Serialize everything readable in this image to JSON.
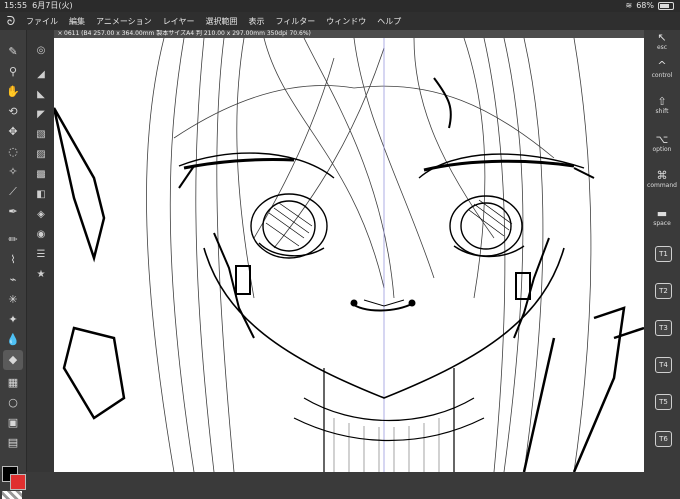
{
  "status_bar": {
    "time": "15:55",
    "date": "6月7日(火)",
    "battery": "68%"
  },
  "menu": {
    "items": [
      "ファイル",
      "編集",
      "アニメーション",
      "レイヤー",
      "選択範囲",
      "表示",
      "フィルター",
      "ウィンドウ",
      "ヘルプ"
    ]
  },
  "document": {
    "tab_title": "0611 (B4 257.00 x 364.00mm 製本サイズA4 判 210.00 x 297.00mm 350dpi 70.6%)"
  },
  "modifiers": [
    {
      "icon": "esc-icon",
      "label": "esc"
    },
    {
      "icon": "control-icon",
      "label": "control"
    },
    {
      "icon": "shift-icon",
      "label": "shift"
    },
    {
      "icon": "option-icon",
      "label": "option"
    },
    {
      "icon": "command-icon",
      "label": "command"
    },
    {
      "icon": "space-icon",
      "label": "space"
    }
  ],
  "shortcuts": [
    "T1",
    "T2",
    "T3",
    "T4",
    "T5",
    "T6"
  ],
  "colors": {
    "main": "#000000",
    "sub": "#e03030",
    "accent": "#5a5a5a"
  }
}
